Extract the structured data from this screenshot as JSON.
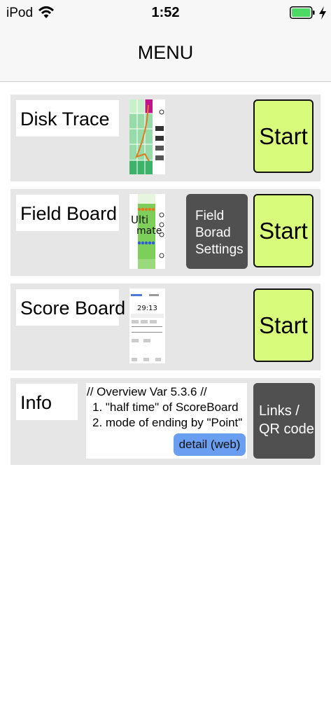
{
  "status_bar": {
    "carrier": "iPod",
    "time": "1:52"
  },
  "nav": {
    "title": "MENU"
  },
  "colors": {
    "start_button": "#d9fb7b",
    "dark_button": "#505050",
    "detail_button": "#6a9ef0",
    "card_background": "#e6e6e6",
    "battery": "#4cd964"
  },
  "cards": {
    "disk_trace": {
      "label": "Disk Trace",
      "start_label": "Start"
    },
    "field_board": {
      "label": "Field Board",
      "settings_lines": [
        "Field",
        "Borad",
        "Settings"
      ],
      "start_label": "Start"
    },
    "score_board": {
      "label": "Score Board",
      "start_label": "Start"
    },
    "info": {
      "label": "Info",
      "overview_lines": [
        "// Overview Var 5.3.6 //",
        "1. \"half time\" of ScoreBoard",
        "2. mode of ending by \"Point\""
      ],
      "detail_label": "detail (web)",
      "links_lines": [
        "Links /",
        "QR code"
      ]
    }
  },
  "thumbnails": {
    "field_board_text": [
      "Ulti",
      "mate"
    ],
    "score_board_timer": "29:13"
  },
  "icons": [
    "wifi-icon",
    "battery-icon",
    "charging-bolt-icon"
  ]
}
